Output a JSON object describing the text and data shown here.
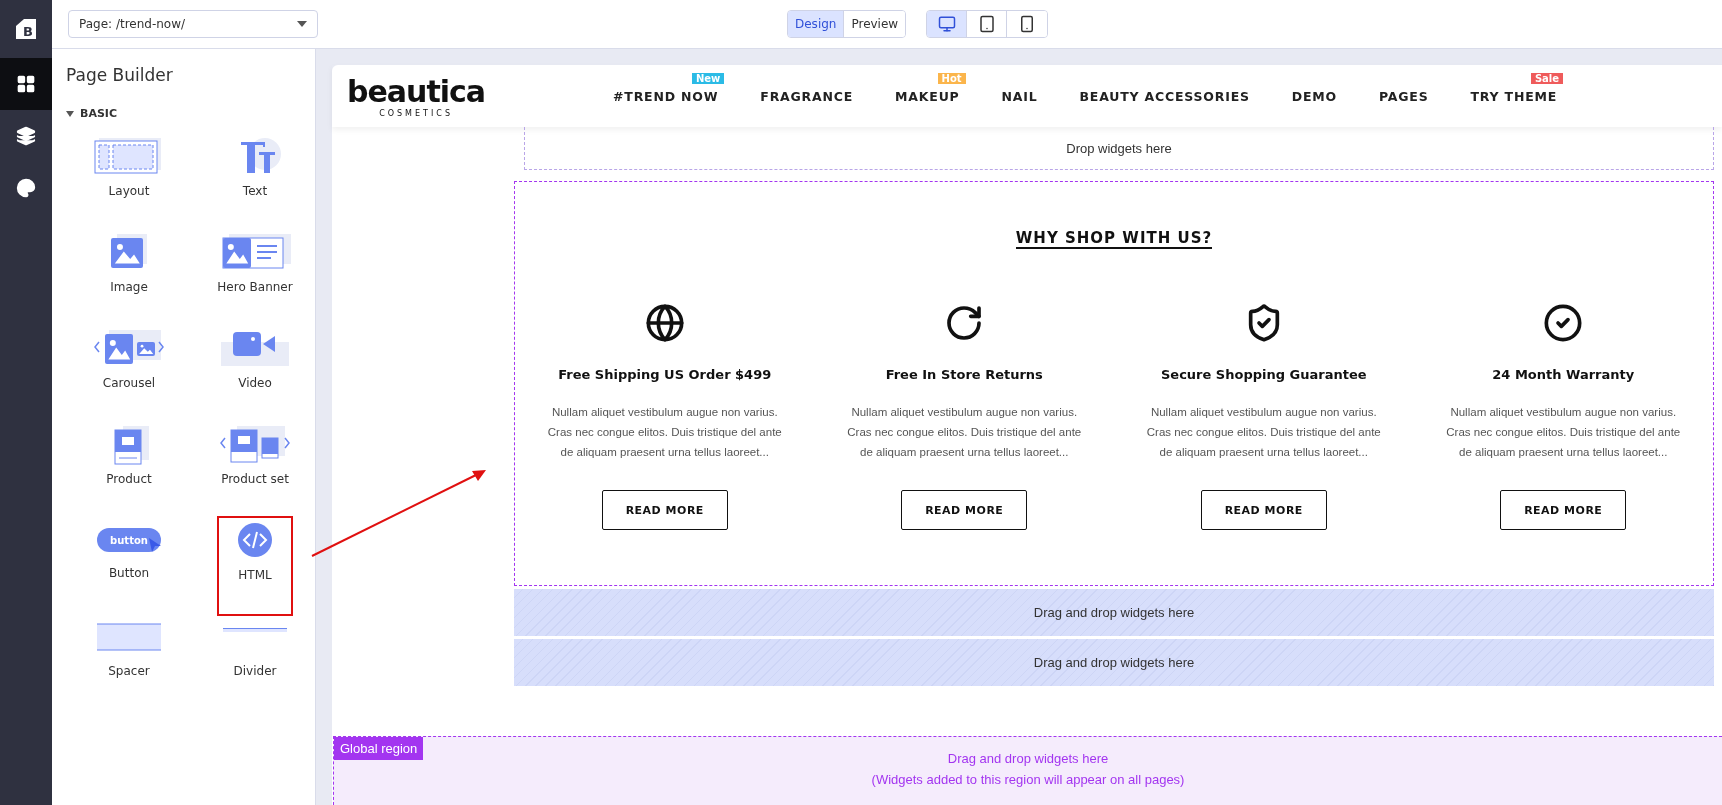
{
  "rail": {
    "brand_mark": "B",
    "items": [
      {
        "kind": "widgets",
        "selected": true
      },
      {
        "kind": "layers",
        "selected": false
      },
      {
        "kind": "theme",
        "selected": false
      }
    ]
  },
  "top_bar": {
    "page_select": "Page: /trend-now/",
    "modes": [
      {
        "label": "Design",
        "selected": true
      },
      {
        "label": "Preview",
        "selected": false
      }
    ],
    "devices": [
      {
        "kind": "desktop",
        "selected": true
      },
      {
        "kind": "tablet",
        "selected": false
      },
      {
        "kind": "mobile",
        "selected": false
      }
    ]
  },
  "panel": {
    "title": "Page Builder",
    "section": "BASIC",
    "expanded": true,
    "widgets": [
      {
        "kind": "layout",
        "label": "Layout",
        "highlighted": false
      },
      {
        "kind": "text",
        "label": "Text",
        "highlighted": false
      },
      {
        "kind": "image",
        "label": "Image",
        "highlighted": false
      },
      {
        "kind": "hero",
        "label": "Hero Banner",
        "highlighted": false
      },
      {
        "kind": "carousel",
        "label": "Carousel",
        "highlighted": false
      },
      {
        "kind": "video",
        "label": "Video",
        "highlighted": false
      },
      {
        "kind": "product",
        "label": "Product",
        "highlighted": false
      },
      {
        "kind": "product_set",
        "label": "Product set",
        "highlighted": false
      },
      {
        "kind": "button",
        "label": "Button",
        "icon_text": "button",
        "highlighted": false
      },
      {
        "kind": "html",
        "label": "HTML",
        "highlighted": true
      },
      {
        "kind": "spacer",
        "label": "Spacer",
        "highlighted": false
      },
      {
        "kind": "divider",
        "label": "Divider",
        "highlighted": false
      }
    ]
  },
  "preview": {
    "logo": "beautica",
    "logo_sub": "COSMETICS",
    "nav": [
      {
        "label": "#TREND NOW",
        "badge": "New",
        "color": "#2bbbe6"
      },
      {
        "label": "FRAGRANCE"
      },
      {
        "label": "MAKEUP",
        "badge": "Hot",
        "color": "#fbb54b"
      },
      {
        "label": "NAIL"
      },
      {
        "label": "BEAUTY ACCESSORIES"
      },
      {
        "label": "DEMO"
      },
      {
        "label": "PAGES"
      },
      {
        "label": "TRY THEME",
        "badge": "Sale",
        "color": "#ef5b5b"
      }
    ],
    "drop_zone": "Drop widgets here",
    "section": {
      "title": "WHY SHOP WITH US?",
      "features": [
        {
          "kind": "globe",
          "title": "Free Shipping US Order $499",
          "text": "Nullam aliquet vestibulum augue non varius. Cras nec congue elitos. Duis tristique del ante de aliquam praesent urna tellus laoreet...",
          "button": "READ MORE"
        },
        {
          "kind": "returns",
          "title": "Free In Store Returns",
          "text": "Nullam aliquet vestibulum augue non varius. Cras nec congue elitos. Duis tristique del ante de aliquam praesent urna tellus laoreet...",
          "button": "READ MORE"
        },
        {
          "kind": "shield",
          "title": "Secure Shopping Guarantee",
          "text": "Nullam aliquet vestibulum augue non varius. Cras nec congue elitos. Duis tristique del ante de aliquam praesent urna tellus laoreet...",
          "button": "READ MORE"
        },
        {
          "kind": "warranty",
          "title": "24 Month Warranty",
          "text": "Nullam aliquet vestibulum augue non varius. Cras nec congue elitos. Duis tristique del ante de aliquam praesent urna tellus laoreet...",
          "button": "READ MORE"
        }
      ]
    },
    "drag_zones": [
      "Drag and drop widgets here",
      "Drag and drop widgets here"
    ],
    "global_region": {
      "label": "Global region",
      "text": "Drag and drop widgets here",
      "note": "(Widgets added to this region will appear on all pages)"
    }
  }
}
